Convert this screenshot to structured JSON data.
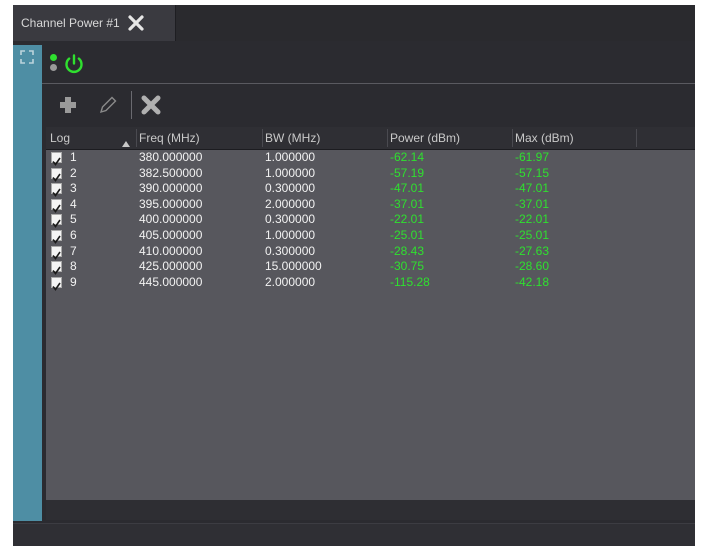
{
  "tab": {
    "label": "Channel Power #1"
  },
  "colors": {
    "accent_strip": "#4e8ea4",
    "power_green": "#2fe02f",
    "dot_green": "#2fe02f",
    "dot_gray": "#9a9a9a"
  },
  "icons": {
    "tab_close": "close-x-icon",
    "expand": "expand-arrows-icon",
    "power": "power-icon",
    "add": "plus-icon",
    "edit": "pencil-icon",
    "delete": "delete-x-icon",
    "sort": "sort-up-icon"
  },
  "table": {
    "columns": [
      "Log",
      "Freq (MHz)",
      "BW (MHz)",
      "Power (dBm)",
      "Max (dBm)"
    ],
    "rows": [
      {
        "checked": true,
        "log": "1",
        "freq": "380.000000",
        "bw": "1.000000",
        "power": "-62.14",
        "max": "-61.97"
      },
      {
        "checked": true,
        "log": "2",
        "freq": "382.500000",
        "bw": "1.000000",
        "power": "-57.19",
        "max": "-57.15"
      },
      {
        "checked": true,
        "log": "3",
        "freq": "390.000000",
        "bw": "0.300000",
        "power": "-47.01",
        "max": "-47.01"
      },
      {
        "checked": true,
        "log": "4",
        "freq": "395.000000",
        "bw": "2.000000",
        "power": "-37.01",
        "max": "-37.01"
      },
      {
        "checked": true,
        "log": "5",
        "freq": "400.000000",
        "bw": "0.300000",
        "power": "-22.01",
        "max": "-22.01"
      },
      {
        "checked": true,
        "log": "6",
        "freq": "405.000000",
        "bw": "1.000000",
        "power": "-25.01",
        "max": "-25.01"
      },
      {
        "checked": true,
        "log": "7",
        "freq": "410.000000",
        "bw": "0.300000",
        "power": "-28.43",
        "max": "-27.63"
      },
      {
        "checked": true,
        "log": "8",
        "freq": "425.000000",
        "bw": "15.000000",
        "power": "-30.75",
        "max": "-28.60"
      },
      {
        "checked": true,
        "log": "9",
        "freq": "445.000000",
        "bw": "2.000000",
        "power": "-115.28",
        "max": "-42.18"
      }
    ]
  }
}
